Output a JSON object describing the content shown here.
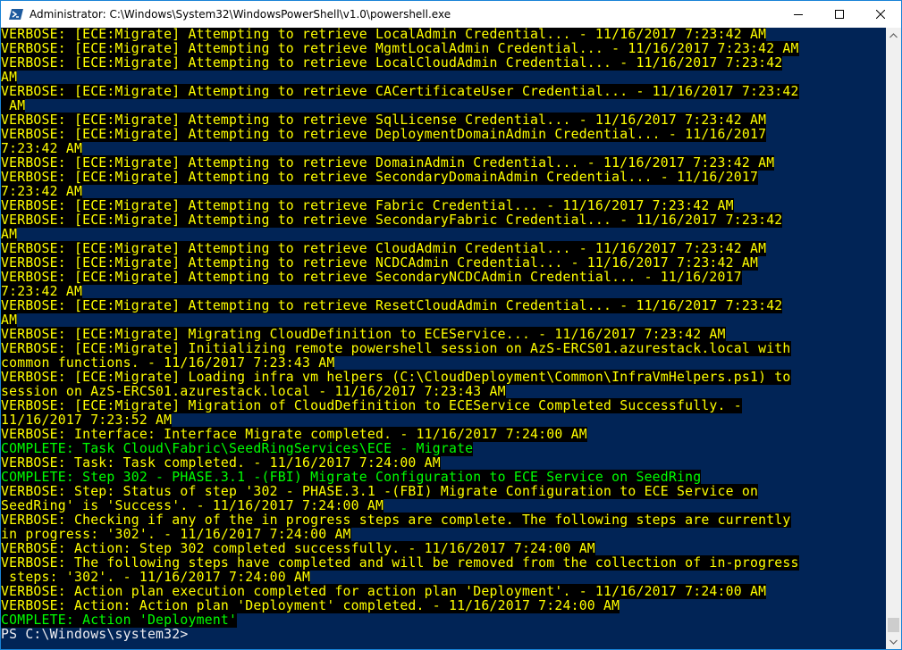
{
  "window": {
    "title": "Administrator: C:\\Windows\\System32\\WindowsPowerShell\\v1.0\\powershell.exe",
    "icon": "powershell-icon",
    "controls": [
      "minimize-icon",
      "maximize-icon",
      "close-icon"
    ]
  },
  "colors": {
    "background": "#012456",
    "verbose": "#ffff00",
    "complete": "#00ff00",
    "prompt": "#eeedf0"
  },
  "console": {
    "lines": [
      {
        "type": "verbose",
        "text": "VERBOSE: [ECE:Migrate] Attempting to retrieve LocalAdmin Credential... - 11/16/2017 7:23:42 AM"
      },
      {
        "type": "verbose",
        "text": "VERBOSE: [ECE:Migrate] Attempting to retrieve MgmtLocalAdmin Credential... - 11/16/2017 7:23:42 AM"
      },
      {
        "type": "verbose",
        "text": "VERBOSE: [ECE:Migrate] Attempting to retrieve LocalCloudAdmin Credential... - 11/16/2017 7:23:42"
      },
      {
        "type": "verbose",
        "text": "AM"
      },
      {
        "type": "verbose",
        "text": "VERBOSE: [ECE:Migrate] Attempting to retrieve CACertificateUser Credential... - 11/16/2017 7:23:42"
      },
      {
        "type": "verbose",
        "text": " AM"
      },
      {
        "type": "verbose",
        "text": "VERBOSE: [ECE:Migrate] Attempting to retrieve SqlLicense Credential... - 11/16/2017 7:23:42 AM"
      },
      {
        "type": "verbose",
        "text": "VERBOSE: [ECE:Migrate] Attempting to retrieve DeploymentDomainAdmin Credential... - 11/16/2017"
      },
      {
        "type": "verbose",
        "text": "7:23:42 AM"
      },
      {
        "type": "verbose",
        "text": "VERBOSE: [ECE:Migrate] Attempting to retrieve DomainAdmin Credential... - 11/16/2017 7:23:42 AM"
      },
      {
        "type": "verbose",
        "text": "VERBOSE: [ECE:Migrate] Attempting to retrieve SecondaryDomainAdmin Credential... - 11/16/2017"
      },
      {
        "type": "verbose",
        "text": "7:23:42 AM"
      },
      {
        "type": "verbose",
        "text": "VERBOSE: [ECE:Migrate] Attempting to retrieve Fabric Credential... - 11/16/2017 7:23:42 AM"
      },
      {
        "type": "verbose",
        "text": "VERBOSE: [ECE:Migrate] Attempting to retrieve SecondaryFabric Credential... - 11/16/2017 7:23:42"
      },
      {
        "type": "verbose",
        "text": "AM"
      },
      {
        "type": "verbose",
        "text": "VERBOSE: [ECE:Migrate] Attempting to retrieve CloudAdmin Credential... - 11/16/2017 7:23:42 AM"
      },
      {
        "type": "verbose",
        "text": "VERBOSE: [ECE:Migrate] Attempting to retrieve NCDCAdmin Credential... - 11/16/2017 7:23:42 AM"
      },
      {
        "type": "verbose",
        "text": "VERBOSE: [ECE:Migrate] Attempting to retrieve SecondaryNCDCAdmin Credential... - 11/16/2017"
      },
      {
        "type": "verbose",
        "text": "7:23:42 AM"
      },
      {
        "type": "verbose",
        "text": "VERBOSE: [ECE:Migrate] Attempting to retrieve ResetCloudAdmin Credential... - 11/16/2017 7:23:42"
      },
      {
        "type": "verbose",
        "text": "AM"
      },
      {
        "type": "verbose",
        "text": "VERBOSE: [ECE:Migrate] Migrating CloudDefinition to ECEService... - 11/16/2017 7:23:42 AM"
      },
      {
        "type": "verbose",
        "text": "VERBOSE: [ECE:Migrate] Initializing remote powershell session on AzS-ERCS01.azurestack.local with"
      },
      {
        "type": "verbose",
        "text": "common functions. - 11/16/2017 7:23:43 AM"
      },
      {
        "type": "verbose",
        "text": "VERBOSE: [ECE:Migrate] Loading infra vm helpers (C:\\CloudDeployment\\Common\\InfraVmHelpers.ps1) to"
      },
      {
        "type": "verbose",
        "text": "session on AzS-ERCS01.azurestack.local - 11/16/2017 7:23:43 AM"
      },
      {
        "type": "verbose",
        "text": "VERBOSE: [ECE:Migrate] Migration of CloudDefinition to ECEService Completed Successfully. -"
      },
      {
        "type": "verbose",
        "text": "11/16/2017 7:23:52 AM"
      },
      {
        "type": "verbose",
        "text": "VERBOSE: Interface: Interface Migrate completed. - 11/16/2017 7:24:00 AM"
      },
      {
        "type": "complete",
        "text": "COMPLETE: Task Cloud\\Fabric\\SeedRingServices\\ECE - Migrate"
      },
      {
        "type": "verbose",
        "text": "VERBOSE: Task: Task completed. - 11/16/2017 7:24:00 AM"
      },
      {
        "type": "complete",
        "text": "COMPLETE: Step 302 - PHASE.3.1 -(FBI) Migrate Configuration to ECE Service on SeedRing"
      },
      {
        "type": "verbose",
        "text": "VERBOSE: Step: Status of step '302 - PHASE.3.1 -(FBI) Migrate Configuration to ECE Service on"
      },
      {
        "type": "verbose",
        "text": "SeedRing' is 'Success'. - 11/16/2017 7:24:00 AM"
      },
      {
        "type": "verbose",
        "text": "VERBOSE: Checking if any of the in progress steps are complete. The following steps are currently"
      },
      {
        "type": "verbose",
        "text": "in progress: '302'. - 11/16/2017 7:24:00 AM"
      },
      {
        "type": "verbose",
        "text": "VERBOSE: Action: Step 302 completed successfully. - 11/16/2017 7:24:00 AM"
      },
      {
        "type": "verbose",
        "text": "VERBOSE: The following steps have completed and will be removed from the collection of in-progress"
      },
      {
        "type": "verbose",
        "text": " steps: '302'. - 11/16/2017 7:24:00 AM"
      },
      {
        "type": "verbose",
        "text": "VERBOSE: Action plan execution completed for action plan 'Deployment'. - 11/16/2017 7:24:00 AM"
      },
      {
        "type": "verbose",
        "text": "VERBOSE: Action: Action plan 'Deployment' completed. - 11/16/2017 7:24:00 AM"
      },
      {
        "type": "complete",
        "text": "COMPLETE: Action 'Deployment'"
      }
    ],
    "prompt": "PS C:\\Windows\\system32> "
  },
  "scrollbar": {
    "up": "scroll-up-arrow-icon",
    "down": "scroll-down-arrow-icon"
  }
}
